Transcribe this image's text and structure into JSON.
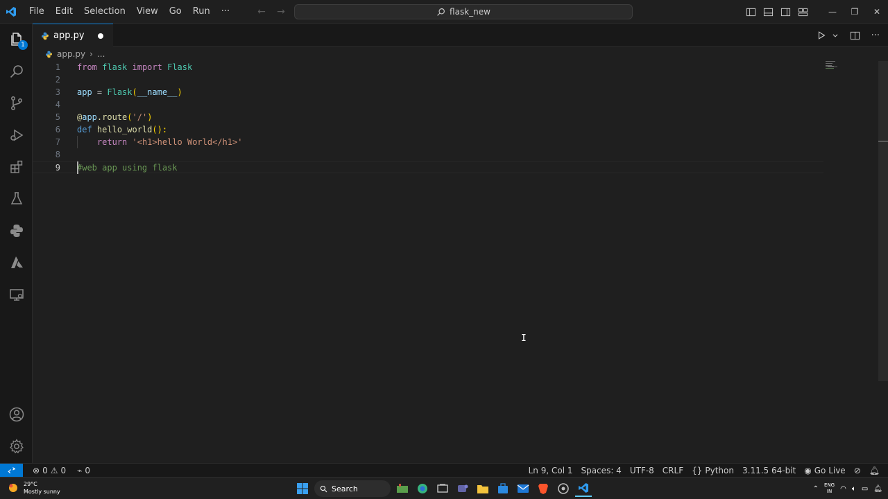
{
  "titlebar": {
    "menu": [
      "File",
      "Edit",
      "Selection",
      "View",
      "Go",
      "Run",
      "···"
    ],
    "search_text": "flask_new"
  },
  "activity_bar": {
    "explorer_badge": "1",
    "icons": [
      "files-icon",
      "search-icon",
      "source-control-icon",
      "run-debug-icon",
      "extensions-icon",
      "testing-icon",
      "python-icon",
      "azure-icon",
      "remote-explorer-icon",
      "account-icon",
      "settings-gear-icon"
    ]
  },
  "tab": {
    "label": "app.py",
    "modified": true
  },
  "breadcrumb": {
    "file": "app.py",
    "sep": "›",
    "rest": "..."
  },
  "editor": {
    "line_numbers": [
      "1",
      "2",
      "3",
      "4",
      "5",
      "6",
      "7",
      "8",
      "9"
    ],
    "current_line": "9",
    "code": {
      "l1_from": "from",
      "l1_mod": "flask",
      "l1_import": "import",
      "l1_cls": "Flask",
      "l3_var": "app",
      "l3_eq": " = ",
      "l3_cls": "Flask",
      "l3_open": "(",
      "l3_arg": "__name__",
      "l3_close": ")",
      "l5_at": "@",
      "l5_obj": "app",
      "l5_dot": ".",
      "l5_fn": "route",
      "l5_open": "(",
      "l5_str": "'/'",
      "l5_close": ")",
      "l6_def": "def",
      "l6_fn": "hello_world",
      "l6_paren": "():",
      "l7_indent": "    ",
      "l7_return": "return",
      "l7_str": "'<h1>hello World</h1>'",
      "l9_comment": "#web app using flask"
    }
  },
  "statusbar": {
    "errors": "0",
    "warnings": "0",
    "ports": "0",
    "position": "Ln 9, Col 1",
    "spaces": "Spaces: 4",
    "encoding": "UTF-8",
    "eol": "CRLF",
    "language": "Python",
    "interpreter": "3.11.5 64-bit",
    "live": "Go Live"
  },
  "taskbar": {
    "temp": "29°C",
    "weather": "Mostly sunny",
    "search": "Search",
    "lang_top": "ENG",
    "lang_bottom": "IN"
  },
  "colors": {
    "accent": "#0078d4",
    "editor_bg": "#1f1f1f",
    "keyword": "#c586c0",
    "string": "#ce9178",
    "comment": "#6a9955"
  }
}
